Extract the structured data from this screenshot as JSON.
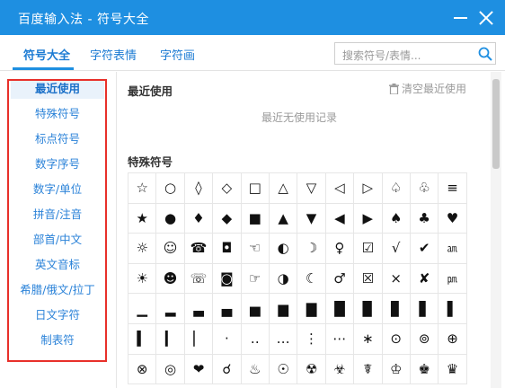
{
  "window": {
    "title": "百度输入法 - 符号大全"
  },
  "tabs": [
    {
      "label": "符号大全"
    },
    {
      "label": "字符表情"
    },
    {
      "label": "字符画"
    }
  ],
  "search": {
    "placeholder": "搜索符号/表情..."
  },
  "sidebar": {
    "items": [
      {
        "label": "最近使用"
      },
      {
        "label": "特殊符号"
      },
      {
        "label": "标点符号"
      },
      {
        "label": "数字序号"
      },
      {
        "label": "数字/单位"
      },
      {
        "label": "拼音/注音"
      },
      {
        "label": "部首/中文"
      },
      {
        "label": "英文音标"
      },
      {
        "label": "希腊/俄文/拉丁"
      },
      {
        "label": "日文字符"
      },
      {
        "label": "制表符"
      }
    ]
  },
  "recent": {
    "title": "最近使用",
    "clear_label": "清空最近使用",
    "empty_text": "最近无使用记录"
  },
  "special": {
    "title": "特殊符号",
    "rows": [
      [
        "☆",
        "○",
        "◊",
        "◇",
        "□",
        "△",
        "▽",
        "◁",
        "▷",
        "♤",
        "♧",
        "≡"
      ],
      [
        "★",
        "●",
        "♦",
        "◆",
        "■",
        "▲",
        "▼",
        "◀",
        "▶",
        "♠",
        "♣",
        "♥"
      ],
      [
        "☼",
        "☺",
        "☎",
        "◘",
        "☜",
        "◐",
        "☽",
        "♀",
        "☑",
        "√",
        "✔",
        "㏂"
      ],
      [
        "☀",
        "☻",
        "☏",
        "◙",
        "☞",
        "◑",
        "☾",
        "♂",
        "☒",
        "×",
        "✘",
        "㏘"
      ],
      [
        "▁",
        "▂",
        "▃",
        "▄",
        "▅",
        "▆",
        "▇",
        "█",
        "▉",
        "▊",
        "▋",
        "▌"
      ],
      [
        "▍",
        "▎",
        "▏",
        "·",
        "‥",
        "…",
        "⋮",
        "⋯",
        "∗",
        "⊙",
        "⊚",
        "⊕"
      ],
      [
        "⊗",
        "◎",
        "❤",
        "☌",
        "♨",
        "☉",
        "☢",
        "☣",
        "☤",
        "♔",
        "♚",
        "♛"
      ]
    ]
  }
}
